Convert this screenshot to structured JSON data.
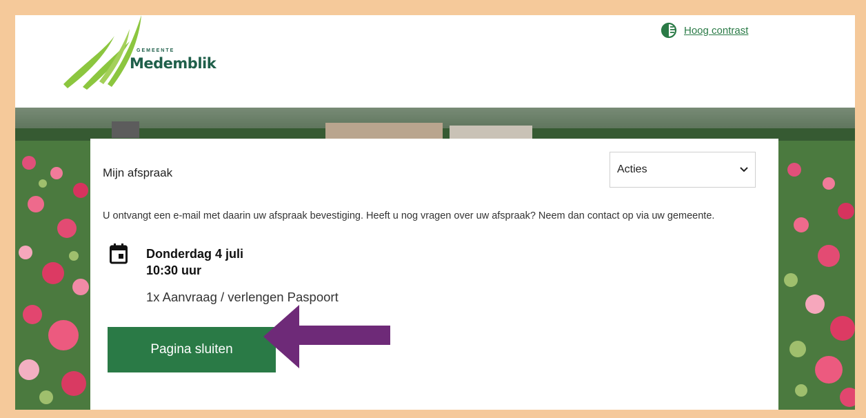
{
  "logo": {
    "small": "GEMEENTE",
    "name": "Medemblik"
  },
  "header": {
    "contrast_label": "Hoog contrast"
  },
  "card": {
    "title": "Mijn afspraak",
    "actions_select": "Acties",
    "info": "U ontvangt een e-mail met daarin uw afspraak bevestiging. Heeft u nog vragen over uw afspraak? Neem dan contact op via uw gemeente.",
    "date": "Donderdag 4 juli",
    "time": "10:30 uur",
    "service": "1x Aanvraag / verlengen Paspoort",
    "close_button": "Pagina sluiten"
  },
  "colors": {
    "accent_green": "#2a7a46",
    "arrow_purple": "#6e2a78",
    "frame_border": "#f5c99a"
  }
}
